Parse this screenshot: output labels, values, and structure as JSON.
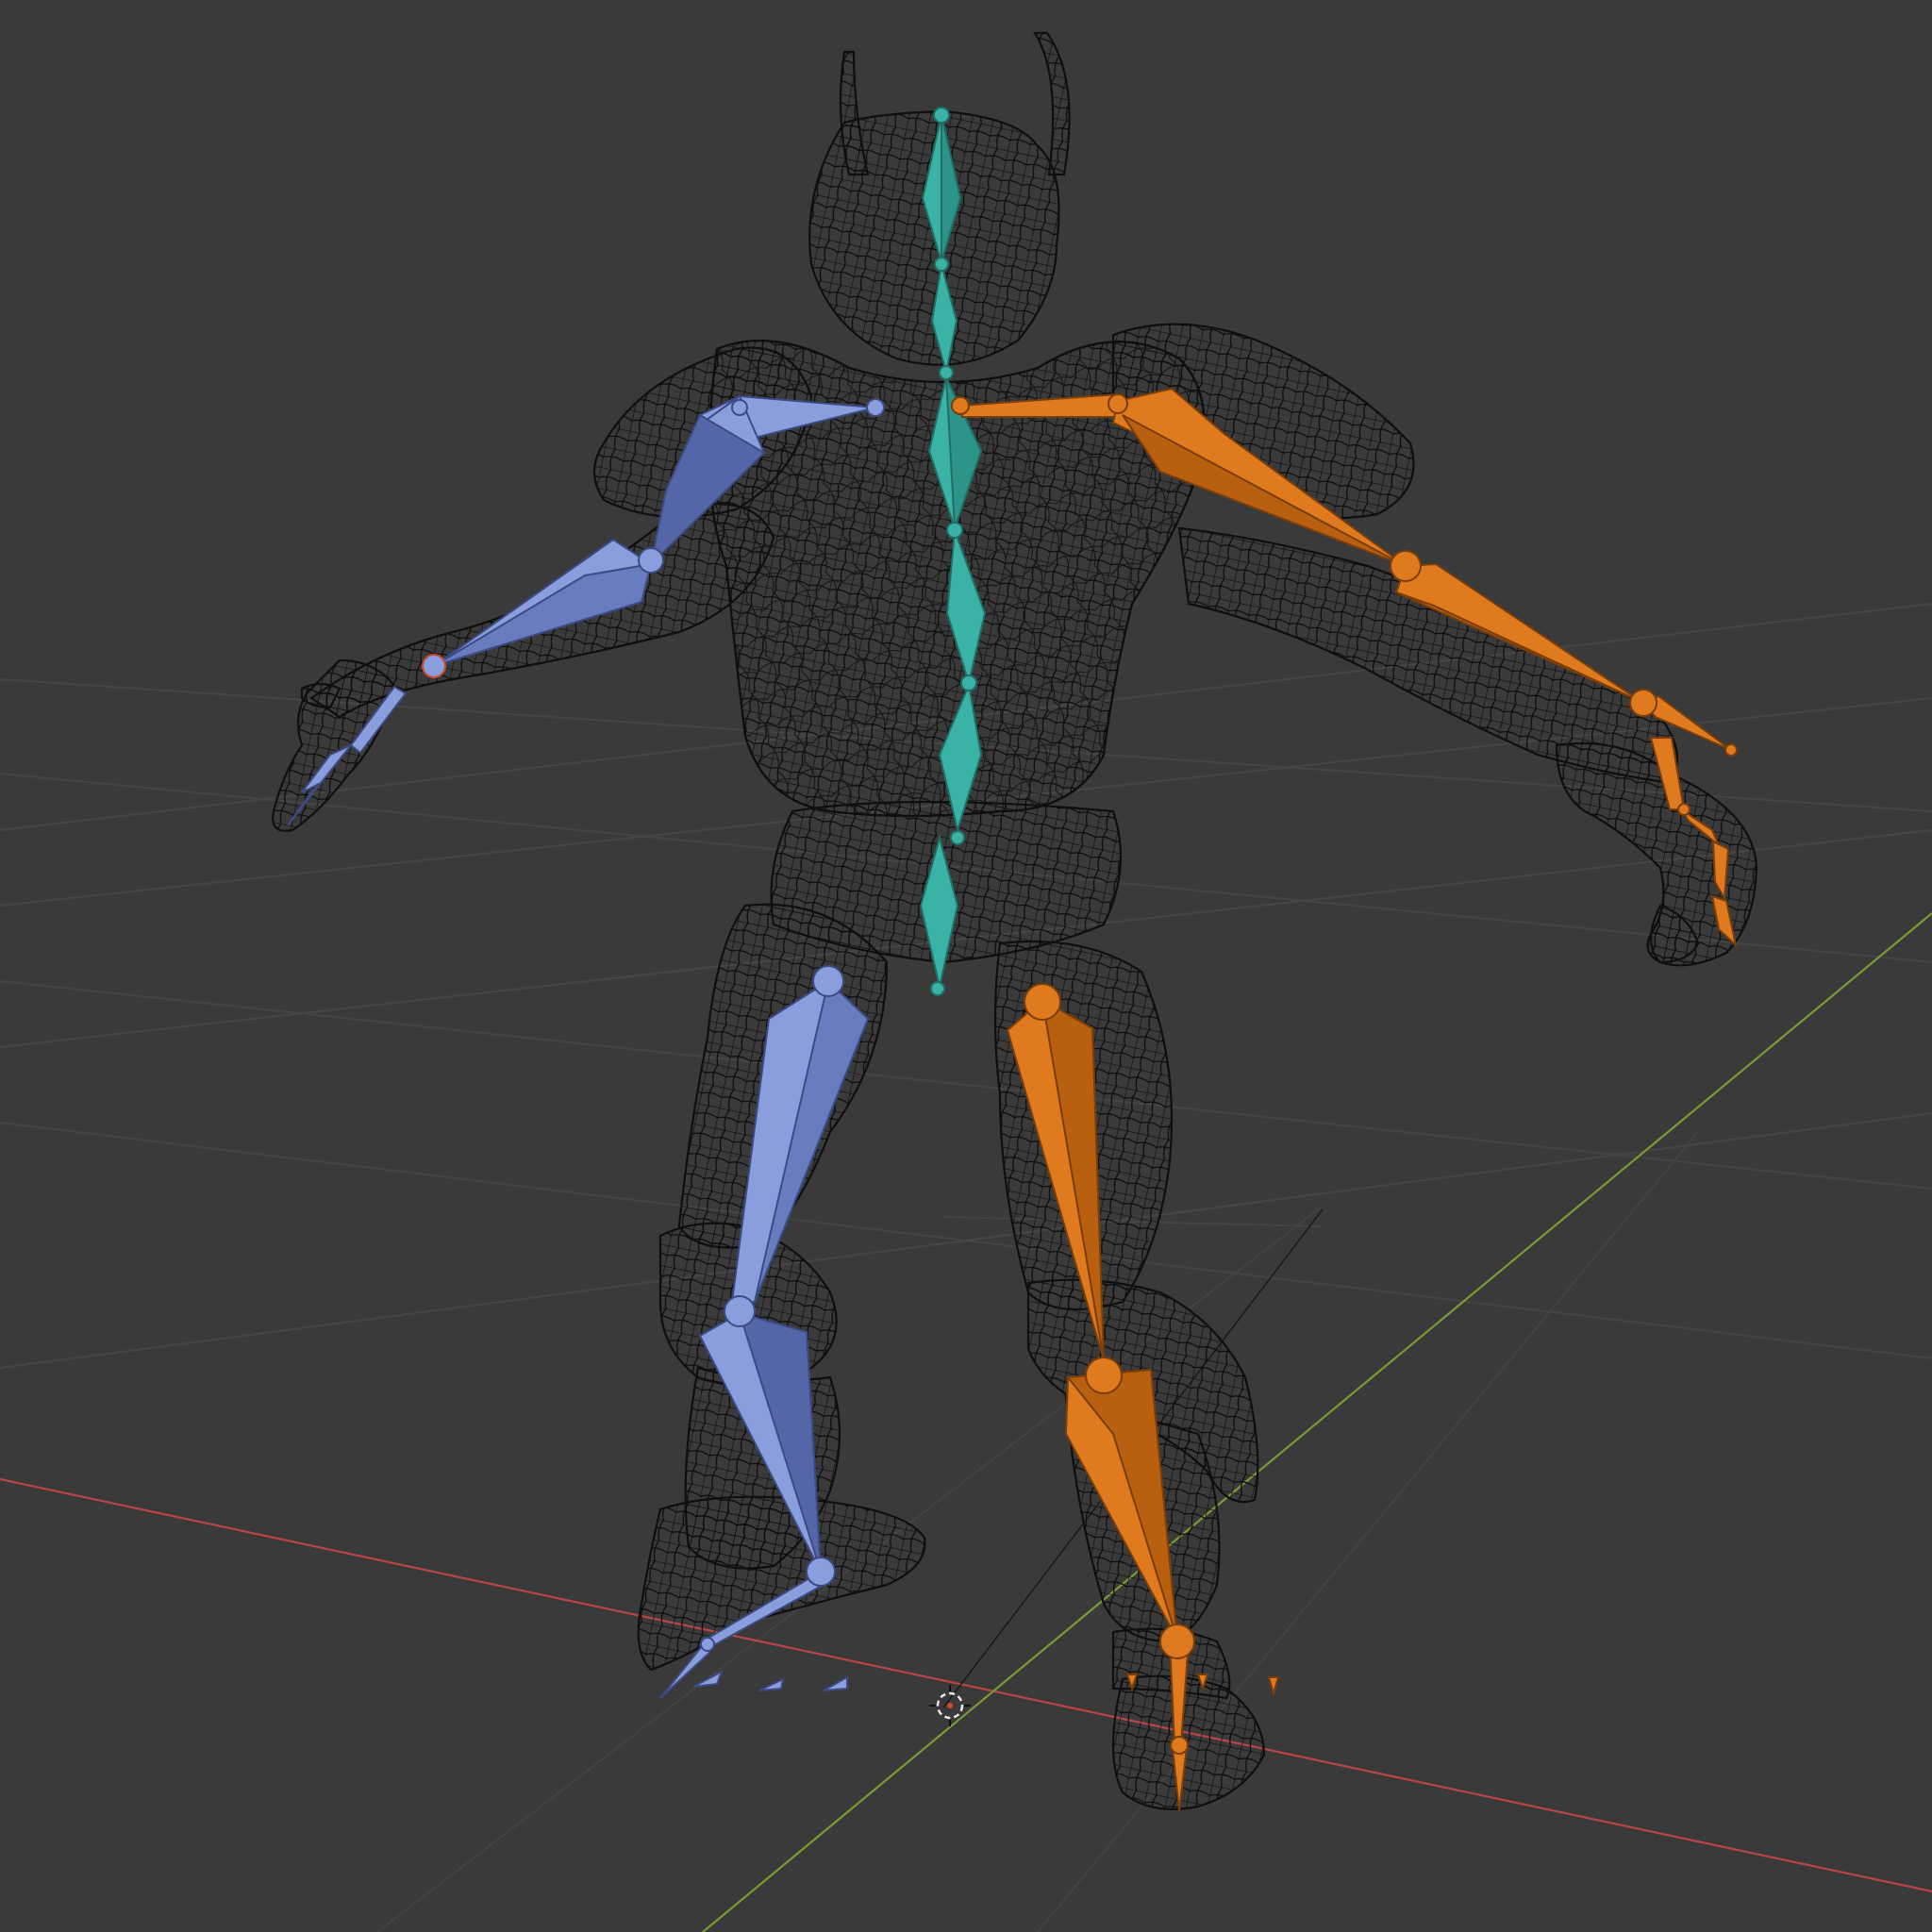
{
  "viewport": {
    "view": "3d-viewport",
    "shading": "wireframe"
  },
  "scene": {
    "objects": [
      "character-mesh",
      "armature"
    ],
    "overlays": [
      "floor-grid",
      "x-axis-line",
      "y-axis-line",
      "3d-cursor"
    ]
  },
  "colors": {
    "background": "#3a3a3a",
    "grid": "#4a4a4a",
    "x_axis": "#c24848",
    "y_axis": "#7d9a3a",
    "wire": "#111111",
    "bone_left": "#8a9ddc",
    "bone_left_dark": "#5566a8",
    "bone_center": "#3ab3a6",
    "bone_center_dark": "#24877c",
    "bone_right": "#e07a1f",
    "bone_right_dark": "#a9560e",
    "cursor_ring": "#e8e8e8",
    "cursor_center": "#d8452a"
  }
}
